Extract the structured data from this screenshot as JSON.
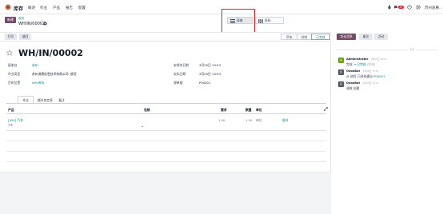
{
  "topbar": {
    "app_name": "库存",
    "menu": [
      "概述",
      "作业",
      "产品",
      "报告",
      "配置"
    ],
    "badge": "23",
    "company": "苏州迪赛..."
  },
  "breadcrumb": {
    "new_label": "新建",
    "parent": "收货",
    "current": "WH/IN/00002"
  },
  "view_switcher": {
    "list": "表格",
    "kanban": "条码"
  },
  "actions": {
    "print": "打印",
    "return": "退回"
  },
  "statusbar": [
    "草稿",
    "就绪",
    "已完成"
  ],
  "status_active": "已完成",
  "form": {
    "reference": "WH/IN/00002",
    "fields_left": [
      {
        "label": "接收自",
        "value": "苏州",
        "link": true
      },
      {
        "label": "作业类型",
        "value": "苏州迪赛信息技术有限公司: 收货",
        "link": false
      },
      {
        "label": "目的位置",
        "value": "WH/库存",
        "link": true
      }
    ],
    "fields_right": [
      {
        "label": "安排的日期",
        "value": "3月25日 13:53"
      },
      {
        "label": "实际日期",
        "value": "3月25日 13:53"
      },
      {
        "label": "源单据",
        "value": "P00001"
      }
    ],
    "tabs": [
      "作业",
      "额外的信息",
      "备注"
    ],
    "columns": {
      "product": "产品",
      "packaging": "包装",
      "demand": "需求",
      "quantity": "数量",
      "uom": "单位"
    },
    "line": {
      "product": "[000] 汽车",
      "product_sub": "汽车",
      "packaging": "",
      "demand": "1.00",
      "quantity": "1.00",
      "uom": "单位",
      "details": "细节"
    }
  },
  "chatter": {
    "send_message": "发送消息",
    "log_note": "备注",
    "activities": "活动",
    "today": "今天",
    "messages": [
      {
        "author": "Administrator",
        "time": "- 3月25日 13:53",
        "body_prefix": "完成",
        "body_highlight": "→ 已完成",
        "body_suffix": "(状态)",
        "avatar_color": "#65a30d",
        "avatar_letter": "A"
      },
      {
        "author": "OdooBot",
        "time": "- 3月25日 13:53",
        "body_prefix": "从 进程 已经创建自",
        "body_highlight": "P00001",
        "body_suffix": "",
        "avatar_color": "#4b5563",
        "avatar_letter": "O"
      },
      {
        "author": "OdooBot",
        "time": "- 3月25日 13:53",
        "body_prefix": "调拨 创建",
        "body_highlight": "",
        "body_suffix": "",
        "avatar_color": "#4b5563",
        "avatar_letter": "O"
      }
    ]
  },
  "colors": {
    "brand": "#714b67",
    "link": "#017e84",
    "highlight_box": "#dc2626"
  }
}
